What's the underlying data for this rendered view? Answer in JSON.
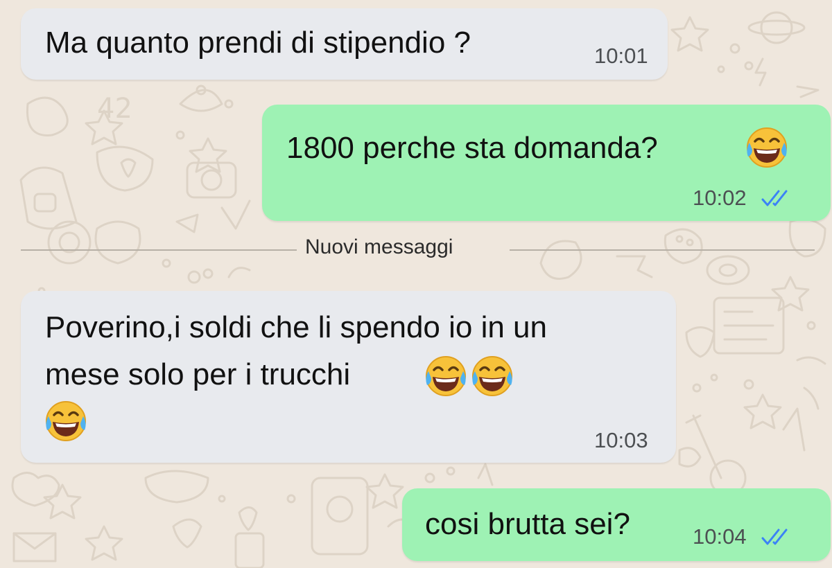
{
  "colors": {
    "background": "#efe7dd",
    "incoming_bubble": "#e8eaee",
    "outgoing_bubble": "#9ef2b4",
    "read_ticks": "#3b82f6"
  },
  "messages": [
    {
      "direction": "incoming",
      "text": "Ma quanto prendi di stipendio ?",
      "time": "10:01"
    },
    {
      "direction": "outgoing",
      "text": "1800 perche sta domanda?",
      "emoji": "face-with-tears-of-joy",
      "time": "10:02",
      "status": "read"
    },
    {
      "direction": "incoming",
      "lines": [
        "Poverino,i soldi che li spendo io in un",
        "mese solo per i trucchi"
      ],
      "emoji": "face-with-tears-of-joy",
      "emoji_count": 3,
      "time": "10:03"
    },
    {
      "direction": "outgoing",
      "text": "cosi brutta sei?",
      "time": "10:04",
      "status": "read"
    }
  ],
  "divider": {
    "label": "Nuovi messaggi"
  }
}
